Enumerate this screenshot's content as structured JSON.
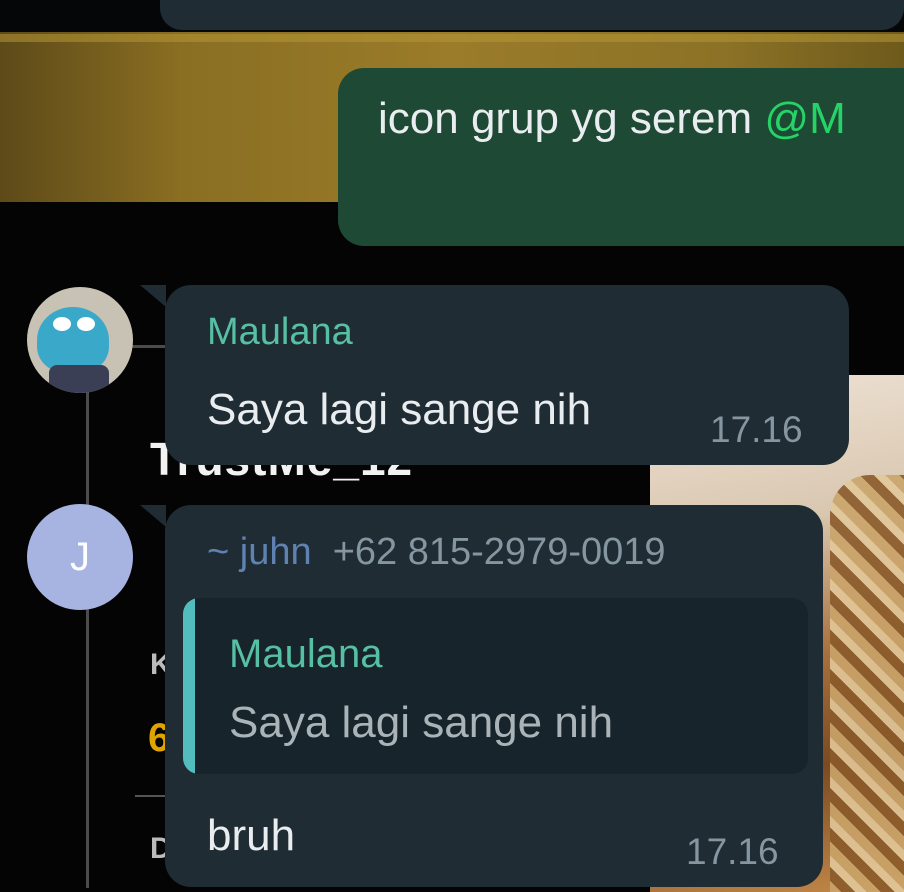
{
  "messages": {
    "outgoing": {
      "text": "icon grup yg serem",
      "mention": "@M"
    },
    "incoming_1": {
      "sender": "Maulana",
      "text": "Saya lagi sange nih",
      "time": "17.16"
    },
    "incoming_2": {
      "avatar_letter": "J",
      "sender_name": "~ juhn",
      "sender_phone": "+62 815-2979-0019",
      "quote": {
        "sender": "Maulana",
        "text": "Saya lagi sange nih"
      },
      "text": "bruh",
      "time": "17.16"
    }
  },
  "wallpaper": {
    "name_text": "TrustMe_12",
    "letters": [
      "K",
      "6",
      "D"
    ]
  },
  "colors": {
    "incoming_bubble": "#1f2c34",
    "outgoing_bubble": "#1e4935",
    "sender_name": "#57bfa3",
    "mention": "#25d366",
    "quote_bar": "#53bdbd"
  }
}
